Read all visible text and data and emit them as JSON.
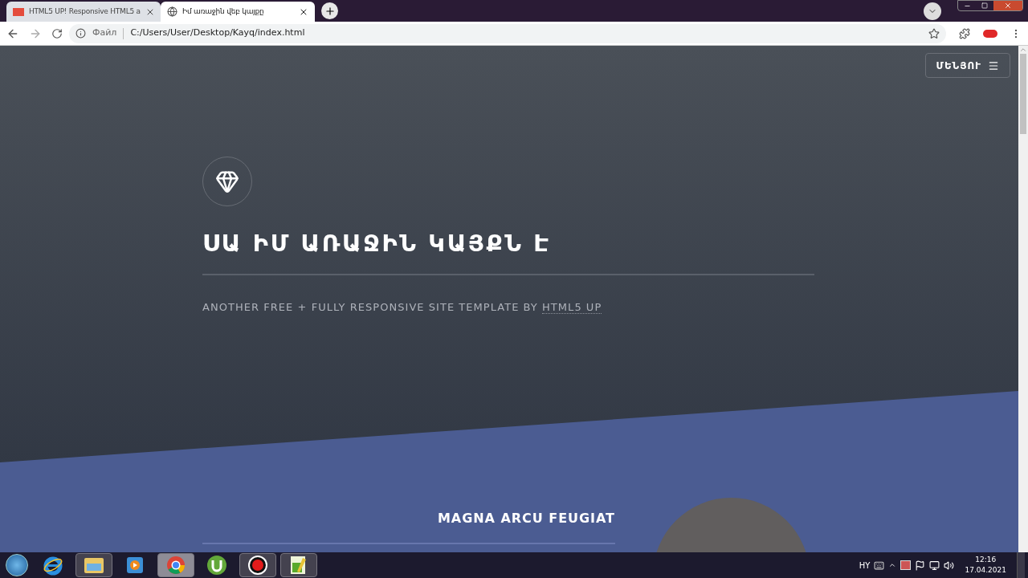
{
  "browser": {
    "tabs": [
      {
        "title": "HTML5 UP! Responsive HTML5 a",
        "kind": "logo",
        "selected": false
      },
      {
        "title": "Իմ առաջին վեբ կայքը",
        "kind": "globe",
        "selected": true
      }
    ],
    "address": {
      "security_label": "Файл",
      "url": "C:/Users/User/Desktop/Kayq/index.html"
    }
  },
  "page": {
    "menu_button": "ՄԵՆՅՈՒ",
    "title": "ՍԱ ԻՄ ԱՌԱՋԻՆ ԿԱՅՔՆ Է",
    "subtitle": "ANOTHER FREE + FULLY RESPONSIVE SITE TEMPLATE BY",
    "subtitle_link": "HTML5 UP",
    "section_heading": "MAGNA ARCU FEUGIAT"
  },
  "taskbar": {
    "apps": [
      {
        "kind": "ie",
        "running": false,
        "selected": false
      },
      {
        "kind": "folder",
        "running": true,
        "selected": false
      },
      {
        "kind": "media",
        "running": false,
        "selected": false
      },
      {
        "kind": "chrome",
        "running": true,
        "selected": true
      },
      {
        "kind": "torrent",
        "running": false,
        "selected": false
      },
      {
        "kind": "record",
        "running": true,
        "selected": false
      },
      {
        "kind": "notepad",
        "running": true,
        "selected": false
      }
    ],
    "language": "HY",
    "time": "12:16",
    "date": "17.04.2021"
  }
}
